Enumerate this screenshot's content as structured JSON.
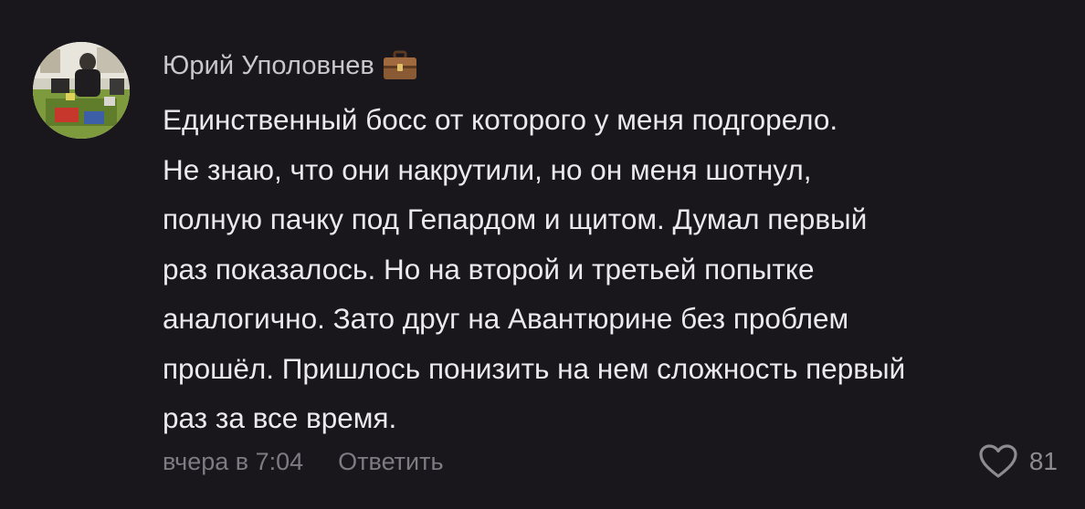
{
  "comment": {
    "author": "Юрий Уполовнев",
    "badge_icon": "briefcase-icon",
    "text": "Единственный босс от которого у меня подгорело.\nНе знаю, что они накрутили, но он меня шотнул,\nполную пачку под Гепардом и щитом. Думал первый\nраз показалось. Но на второй и третьей попытке\nаналогично. Зато друг на Авантюрине без проблем\nпрошёл. Пришлось понизить на нем сложность первый\nраз за все время.",
    "timestamp": "вчера в 7:04",
    "reply_label": "Ответить",
    "like_icon": "heart-outline-icon",
    "like_count": "81"
  },
  "colors": {
    "background": "#19171b",
    "text": "#ece9ee",
    "muted": "#7e7b82"
  }
}
